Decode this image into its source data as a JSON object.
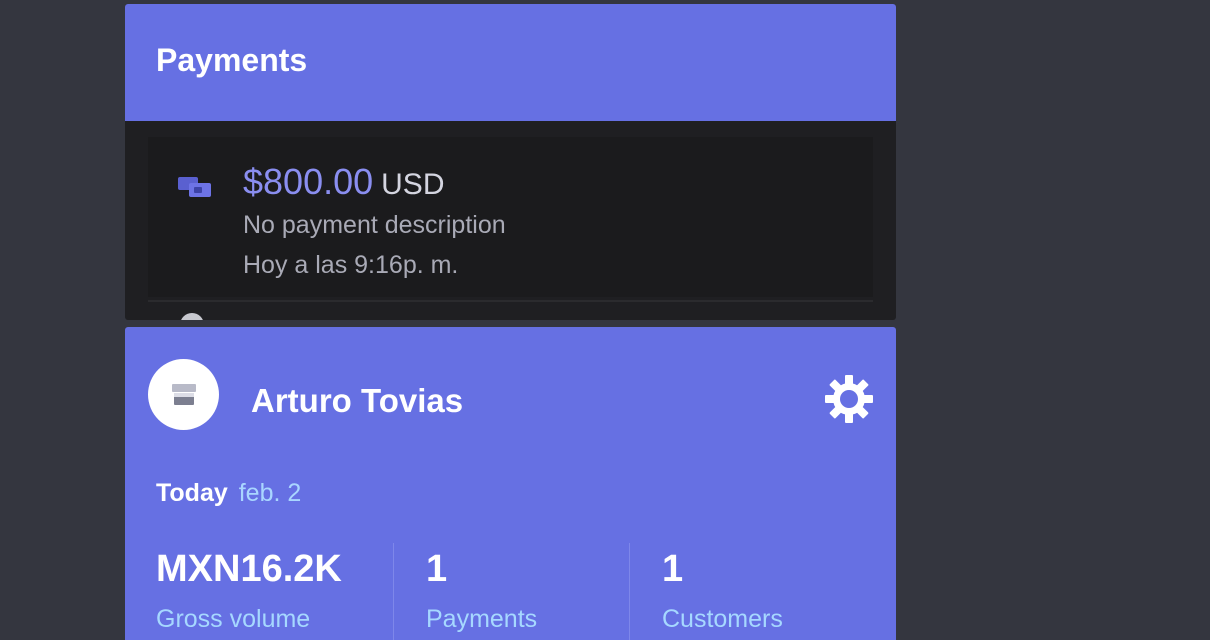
{
  "payments": {
    "title": "Payments",
    "item": {
      "amount": "$800.00",
      "currency": "USD",
      "description": "No payment description",
      "time": "Hoy a las 9:16p. m."
    }
  },
  "account": {
    "name": "Arturo Tovias",
    "today_label": "Today",
    "today_date": "feb. 2",
    "stats": [
      {
        "value": "MXN16.2K",
        "label": "Gross volume"
      },
      {
        "value": "1",
        "label": "Payments"
      },
      {
        "value": "1",
        "label": "Customers"
      }
    ]
  },
  "colors": {
    "accent": "#6670e3",
    "amount": "#8a8ef0",
    "label": "#a6d8ff"
  },
  "icons": {
    "payment": "payment-cards-icon",
    "store": "store-icon",
    "settings": "gear-icon"
  }
}
